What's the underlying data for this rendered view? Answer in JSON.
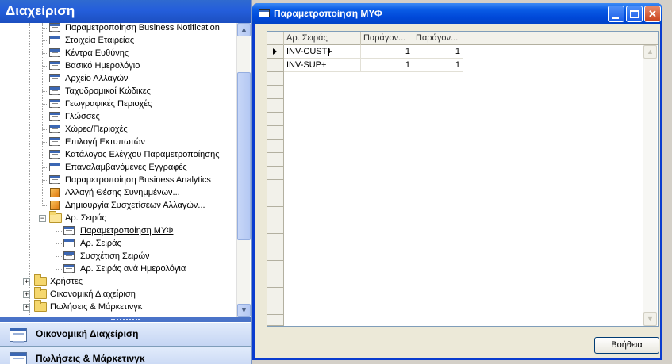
{
  "nav": {
    "title": "Διαχείριση",
    "tree_items": [
      {
        "label": "Παραμετροποίηση Business Notification",
        "icon": "form-icon"
      },
      {
        "label": "Στοιχεία Εταιρείας",
        "icon": "form-icon"
      },
      {
        "label": "Κέντρα Ευθύνης",
        "icon": "form-icon"
      },
      {
        "label": "Βασικό Ημερολόγιο",
        "icon": "form-icon"
      },
      {
        "label": "Αρχείο Αλλαγών",
        "icon": "form-icon"
      },
      {
        "label": "Ταχυδρομικοί Κώδικες",
        "icon": "form-icon"
      },
      {
        "label": "Γεωγραφικές Περιοχές",
        "icon": "form-icon"
      },
      {
        "label": "Γλώσσες",
        "icon": "form-icon"
      },
      {
        "label": "Χώρες/Περιοχές",
        "icon": "form-icon"
      },
      {
        "label": "Επιλογή Εκτυπωτών",
        "icon": "form-icon"
      },
      {
        "label": "Κατάλογος Ελέγχου Παραμετροποίησης",
        "icon": "form-icon"
      },
      {
        "label": "Επαναλαμβανόμενες Εγγραφές",
        "icon": "form-icon"
      },
      {
        "label": "Παραμετροποίηση Business Analytics",
        "icon": "form-icon"
      },
      {
        "label": "Αλλαγή Θέσης Συνημμένων...",
        "icon": "process-icon"
      },
      {
        "label": "Δημιουργία Συσχετίσεων Αλλαγών...",
        "icon": "process-icon"
      }
    ],
    "open_folder": {
      "label": "Αρ. Σειράς",
      "icon": "folder-open-icon",
      "expander": "−",
      "children": [
        {
          "label": "Παραμετροποίηση ΜΥΦ",
          "icon": "form-icon",
          "selected": true
        },
        {
          "label": "Αρ. Σειράς",
          "icon": "form-icon"
        },
        {
          "label": "Συσχέτιση Σειρών",
          "icon": "form-icon"
        },
        {
          "label": "Αρ. Σειράς ανά Ημερολόγια",
          "icon": "form-icon"
        }
      ]
    },
    "top_folders": [
      {
        "label": "Χρήστες",
        "icon": "folder-icon",
        "expander": "+"
      },
      {
        "label": "Οικονομική Διαχείριση",
        "icon": "folder-icon",
        "expander": "+"
      },
      {
        "label": "Πωλήσεις & Μάρκετινγκ",
        "icon": "folder-icon",
        "expander": "+"
      }
    ],
    "scroll_up": "▲",
    "scroll_down": "▼",
    "buttons": [
      {
        "label": "Οικονομική Διαχείριση",
        "icon": "financial-management-icon"
      },
      {
        "label": "Πωλήσεις & Μάρκετινγκ",
        "icon": "sales-marketing-icon"
      }
    ]
  },
  "window": {
    "title": "Παραμετροποίηση ΜΥΦ",
    "title_icon": "form-icon",
    "controls": {
      "minimize": "",
      "maximize": "",
      "close": "✕"
    },
    "grid": {
      "columns": [
        "Αρ. Σειράς",
        "Παράγον...",
        "Παράγον..."
      ],
      "rows": [
        {
          "series": "INV-CUST+",
          "factor1": "1",
          "factor2": "1",
          "current": true
        },
        {
          "series": "INV-SUP+",
          "factor1": "1",
          "factor2": "1",
          "current": false
        }
      ],
      "lookup_glyph": "⬆",
      "scroll_up": "▲",
      "scroll_down": "▼"
    },
    "help_button": "Βοήθεια"
  }
}
